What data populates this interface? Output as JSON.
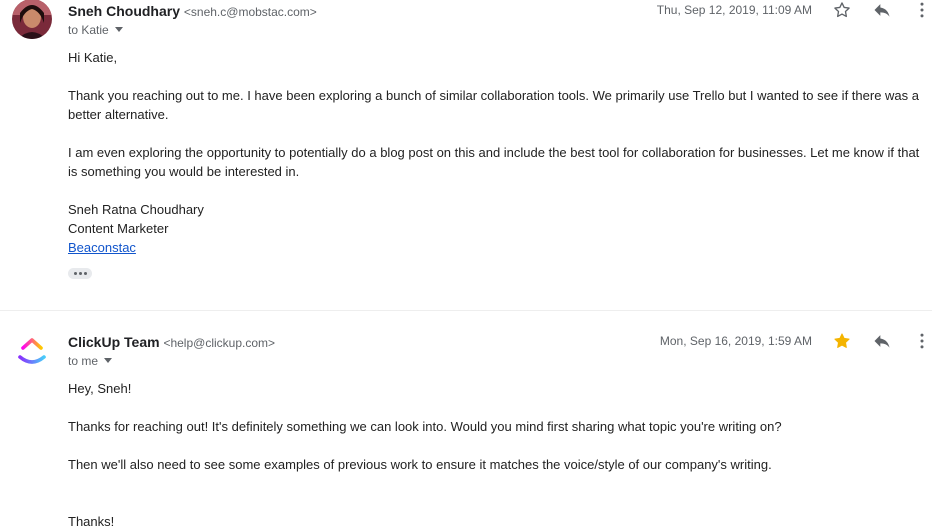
{
  "messages": [
    {
      "sender_name": "Sneh Choudhary",
      "sender_email": "<sneh.c@mobstac.com>",
      "to": "to Katie",
      "date": "Thu, Sep 12, 2019, 11:09 AM",
      "starred": false,
      "body": [
        "Hi Katie,",
        "Thank you reaching out to me. I have been exploring a bunch of similar collaboration tools. We primarily use Trello but I wanted to see if there was a",
        "better alternative.",
        "I am even exploring the opportunity to potentially do a blog post on this and include the best tool for collaboration for businesses. Let me know if that",
        "is something you would be interested in.",
        "Sneh Ratna Choudhary",
        "Content Marketer"
      ],
      "signature_link": "Beaconstac"
    },
    {
      "sender_name": "ClickUp Team",
      "sender_email": "<help@clickup.com>",
      "to": "to me",
      "date": "Mon, Sep 16, 2019, 1:59 AM",
      "starred": true,
      "body": [
        "Hey, Sneh!",
        "Thanks for reaching out! It's definitely something we can look into. Would you mind first sharing what topic you're writing on?",
        "Then we'll also need to see some examples of previous work to ensure it matches the voice/style of our company's writing.",
        "Thanks!"
      ]
    }
  ],
  "icons": {
    "star": "star-icon",
    "reply": "reply-icon",
    "more": "more-vert-icon",
    "logo": "clickup-logo"
  },
  "colors": {
    "star_filled": "#f4b400",
    "link": "#1155cc",
    "secondary_text": "#5f6368"
  }
}
